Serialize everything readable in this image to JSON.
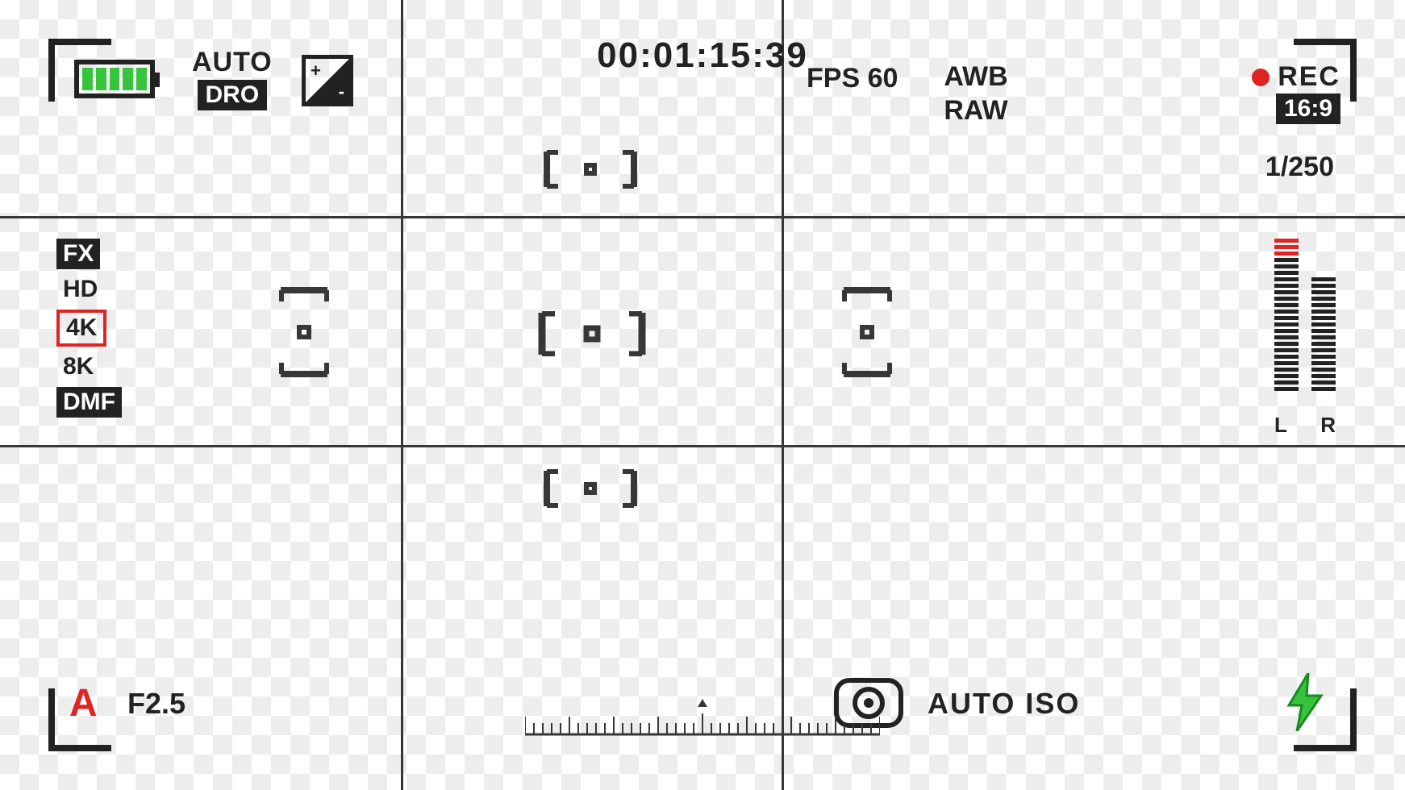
{
  "timecode": "00:01:15:39",
  "top_left": {
    "auto_label": "AUTO",
    "dro_label": "DRO"
  },
  "top_right": {
    "fps": "FPS 60",
    "awb": "AWB",
    "raw": "RAW",
    "rec_label": "REC",
    "aspect": "16:9",
    "shutter": "1/250"
  },
  "mode_stack": {
    "fx": "FX",
    "hd": "HD",
    "k4": "4K",
    "k8": "8K",
    "dmf": "DMF"
  },
  "bottom_left": {
    "mode": "A",
    "fstop": "F2.5"
  },
  "bottom_right": {
    "autoiso": "AUTO ISO"
  },
  "audio": {
    "left_label": "L",
    "right_label": "R"
  }
}
